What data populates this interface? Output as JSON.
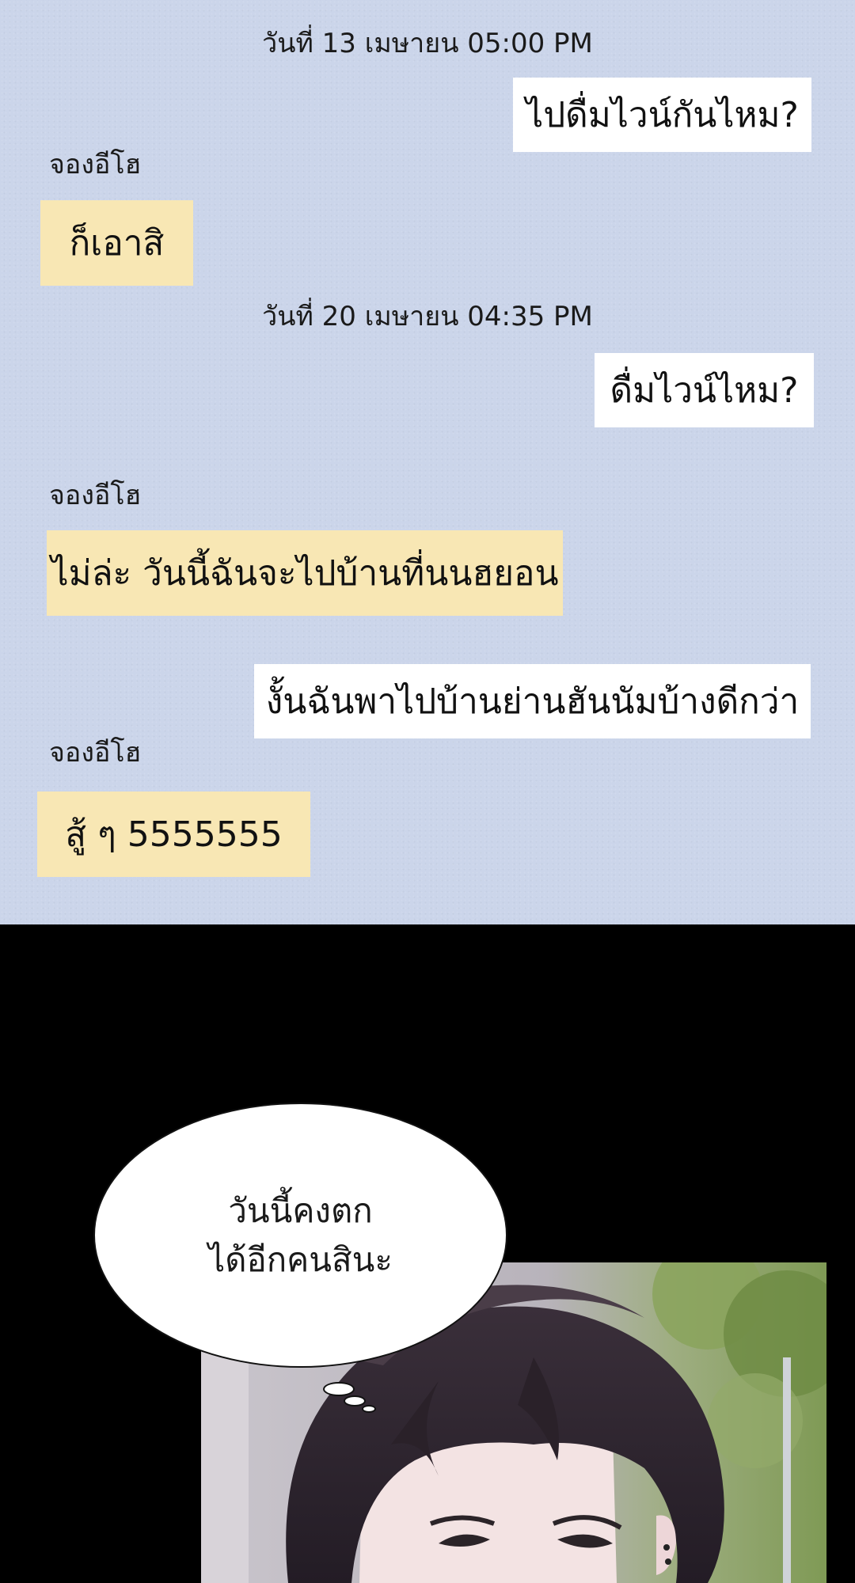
{
  "chat": {
    "timestamps": [
      "วันที่ 13 เมษายน 05:00 PM",
      "วันที่ 20 เมษายน 04:35 PM"
    ],
    "sender_name": "จองอีโฮ",
    "messages": [
      {
        "from": "me",
        "text": "ไปดื่มไวน์กันไหม?"
      },
      {
        "from": "sender",
        "text": "ก็เอาสิ"
      },
      {
        "from": "me",
        "text": "ดื่มไวน์ไหม?"
      },
      {
        "from": "sender",
        "text": "ไม่ล่ะ วันนี้ฉันจะไปบ้านที่นนฮยอน"
      },
      {
        "from": "me",
        "text": "งั้นฉันพาไปบ้านย่านฮันนัมบ้างดีกว่า"
      },
      {
        "from": "sender",
        "text": "สู้ ๆ 5555555"
      }
    ],
    "colors": {
      "background": "#cbd5ea",
      "outgoing": "#ffffff",
      "incoming": "#f8e7b4"
    }
  },
  "panel": {
    "thought_lines": [
      "วันนี้คงตก",
      "ได้อีกคนสินะ"
    ]
  }
}
